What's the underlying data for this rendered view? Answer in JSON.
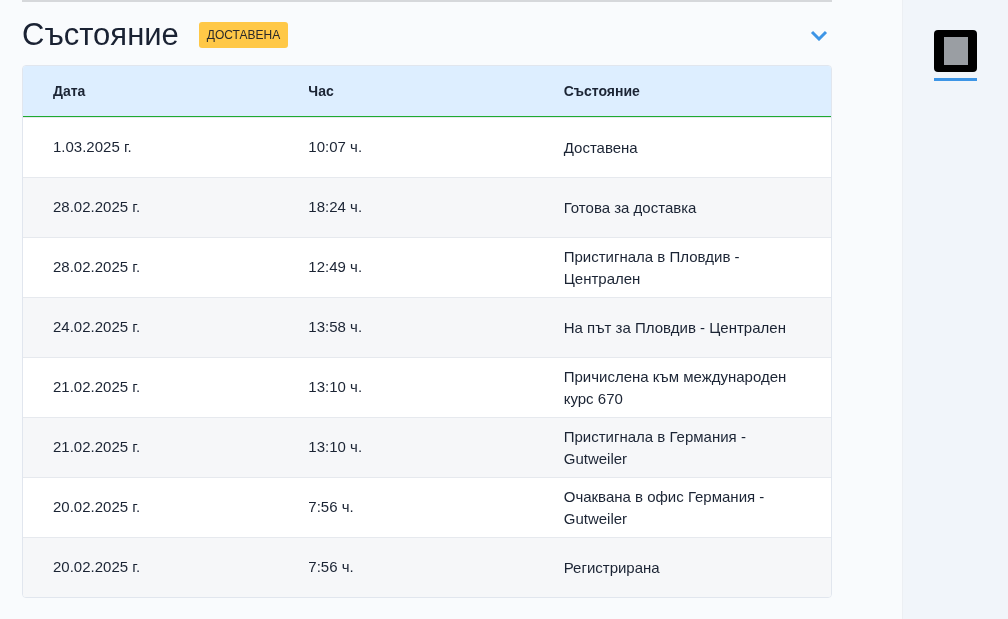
{
  "section": {
    "title": "Състояние",
    "badge": "ДОСТАВЕНА",
    "expanded": true
  },
  "table": {
    "columns": [
      "Дата",
      "Час",
      "Състояние"
    ],
    "rows": [
      {
        "date": "1.03.2025 г.",
        "time": "10:07 ч.",
        "status": "Доставена"
      },
      {
        "date": "28.02.2025 г.",
        "time": "18:24 ч.",
        "status": "Готова за доставка"
      },
      {
        "date": "28.02.2025 г.",
        "time": "12:49 ч.",
        "status": "Пристигнала в Пловдив - Централен"
      },
      {
        "date": "24.02.2025 г.",
        "time": "13:58 ч.",
        "status": "На път за Пловдив - Централен"
      },
      {
        "date": "21.02.2025 г.",
        "time": "13:10 ч.",
        "status": "Причислена към международен курс 670"
      },
      {
        "date": "21.02.2025 г.",
        "time": "13:10 ч.",
        "status": "Пристигнала в Германия - Gutweiler"
      },
      {
        "date": "20.02.2025 г.",
        "time": "7:56 ч.",
        "status": "Очаквана в офис Германия - Gutweiler"
      },
      {
        "date": "20.02.2025 г.",
        "time": "7:56 ч.",
        "status": "Регистрирана"
      }
    ]
  },
  "thumbnails": [
    {
      "selected": true
    }
  ]
}
